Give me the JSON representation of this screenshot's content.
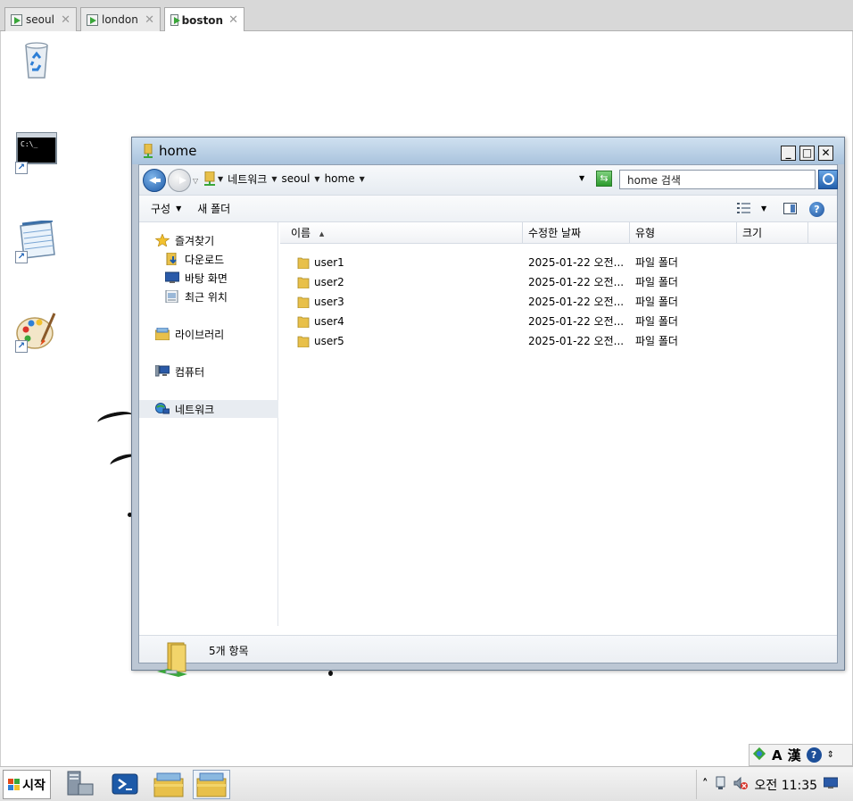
{
  "vm_tabs": [
    {
      "label": "seoul",
      "active": false
    },
    {
      "label": "london",
      "active": false
    },
    {
      "label": "boston",
      "active": true
    }
  ],
  "desktop": {
    "icons": [
      "recycle-bin-icon",
      "command-prompt-icon",
      "notepad-icon",
      "paint-icon"
    ]
  },
  "window": {
    "title": "home",
    "address": {
      "segments": [
        "네트워크",
        "seoul",
        "home"
      ]
    },
    "search_placeholder": "home 검색",
    "toolbar": {
      "organize": "구성",
      "new_folder": "새 폴더"
    },
    "nav": {
      "favorites": "즐겨찾기",
      "downloads": "다운로드",
      "desktop": "바탕 화면",
      "recent": "최근 위치",
      "libraries": "라이브러리",
      "computer": "컴퓨터",
      "network": "네트워크"
    },
    "columns": {
      "name": "이름",
      "date": "수정한 날짜",
      "type": "유형",
      "size": "크기"
    },
    "rows": [
      {
        "name": "user1",
        "date": "2025-01-22 오전...",
        "type": "파일 폴더"
      },
      {
        "name": "user2",
        "date": "2025-01-22 오전...",
        "type": "파일 폴더"
      },
      {
        "name": "user3",
        "date": "2025-01-22 오전...",
        "type": "파일 폴더"
      },
      {
        "name": "user4",
        "date": "2025-01-22 오전...",
        "type": "파일 폴더"
      },
      {
        "name": "user5",
        "date": "2025-01-22 오전...",
        "type": "파일 폴더"
      }
    ],
    "status": {
      "item_count": "5개 항목"
    }
  },
  "langbar": {
    "letter_a": "A",
    "hanja": "漢",
    "help": "?"
  },
  "taskbar": {
    "start_label": "시작",
    "tray_arrow": "˄",
    "clock": "오전 11:35"
  },
  "colors": {
    "accent": "#1d5aa8",
    "folder": "#e8c04a",
    "title_gradient_top": "#cfe0f0"
  }
}
